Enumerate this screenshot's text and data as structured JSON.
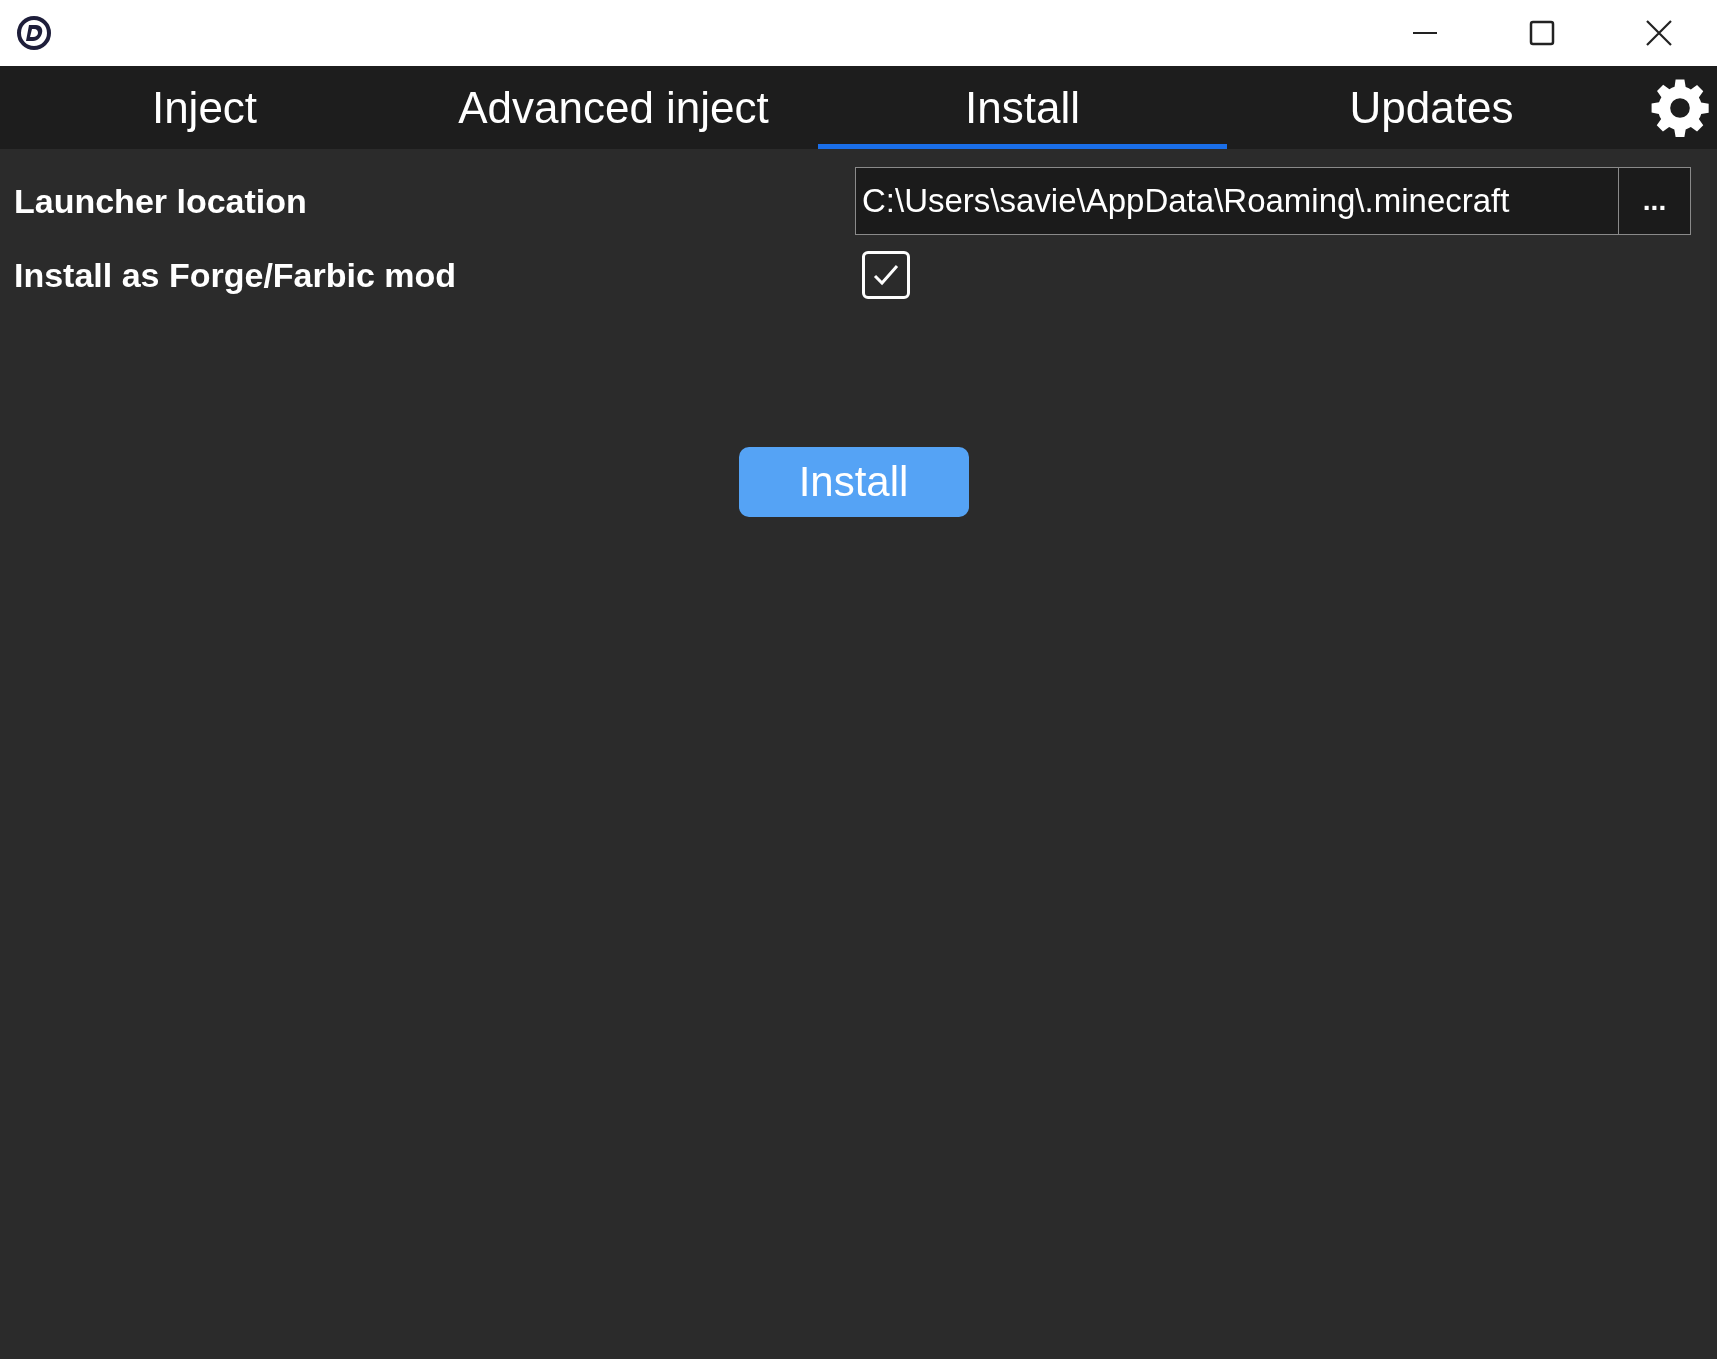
{
  "tabs": [
    {
      "label": "Inject",
      "selected": false
    },
    {
      "label": "Advanced inject",
      "selected": false
    },
    {
      "label": "Install",
      "selected": true
    },
    {
      "label": "Updates",
      "selected": false
    }
  ],
  "settings": [
    {
      "label": "Launcher location",
      "kind": "path",
      "value": "C:\\Users\\savie\\AppData\\Roaming\\.minecraft",
      "browse": "..."
    },
    {
      "label": "Install as Forge/Farbic mod",
      "kind": "checkbox",
      "checked": true
    }
  ],
  "action": "Install"
}
